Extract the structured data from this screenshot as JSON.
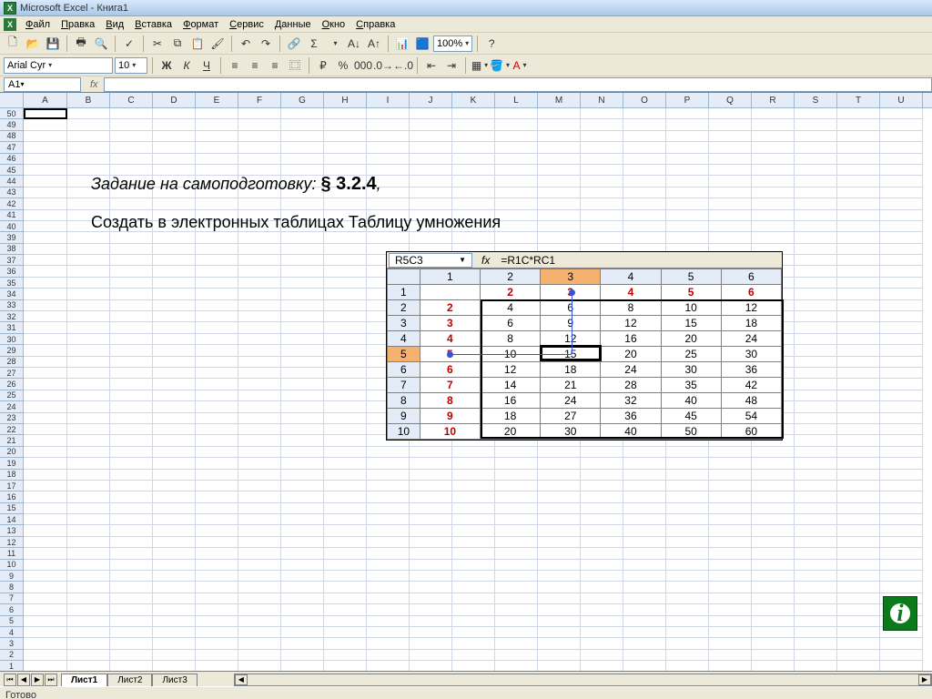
{
  "title": "Microsoft Excel - Книга1",
  "menu": [
    "Файл",
    "Правка",
    "Вид",
    "Вставка",
    "Формат",
    "Сервис",
    "Данные",
    "Окно",
    "Справка"
  ],
  "menu_underlines": [
    "Ф",
    "П",
    "В",
    "В",
    "Ф",
    "С",
    "Д",
    "О",
    "С"
  ],
  "font": {
    "name": "Arial Cyr",
    "size": "10"
  },
  "zoom": "100%",
  "name_box": "A1",
  "formula": "",
  "columns": [
    "A",
    "B",
    "C",
    "D",
    "E",
    "F",
    "G",
    "H",
    "I",
    "J",
    "K",
    "L",
    "M",
    "N",
    "O",
    "P",
    "Q",
    "R",
    "S",
    "T",
    "U"
  ],
  "row_count": 50,
  "task": {
    "line1_a": "Задание на самоподготовку:",
    "line1_b": "§ 3.2.4",
    "line1_c": ",",
    "line2": "Создать в электронных таблицах Таблицу умножения"
  },
  "embed": {
    "name_box": "R5C3",
    "formula": "=R1C*RC1",
    "col_headers": [
      "1",
      "2",
      "3",
      "4",
      "5",
      "6"
    ],
    "row_headers": [
      "1",
      "2",
      "3",
      "4",
      "5",
      "6",
      "7",
      "8",
      "9",
      "10"
    ],
    "first_row": [
      "2",
      "3",
      "4",
      "5",
      "6"
    ],
    "first_col": [
      "2",
      "3",
      "4",
      "5",
      "6",
      "7",
      "8",
      "9",
      "10"
    ],
    "body": [
      [
        "4",
        "6",
        "8",
        "10",
        "12"
      ],
      [
        "6",
        "9",
        "12",
        "15",
        "18"
      ],
      [
        "8",
        "12",
        "16",
        "20",
        "24"
      ],
      [
        "10",
        "15",
        "20",
        "25",
        "30"
      ],
      [
        "12",
        "18",
        "24",
        "30",
        "36"
      ],
      [
        "14",
        "21",
        "28",
        "35",
        "42"
      ],
      [
        "16",
        "24",
        "32",
        "40",
        "48"
      ],
      [
        "18",
        "27",
        "36",
        "45",
        "54"
      ],
      [
        "20",
        "30",
        "40",
        "50",
        "60"
      ]
    ],
    "selected_col": 2,
    "selected_row": 4
  },
  "sheets": {
    "active": "Лист1",
    "others": [
      "Лист2",
      "Лист3"
    ]
  },
  "status": "Готово"
}
